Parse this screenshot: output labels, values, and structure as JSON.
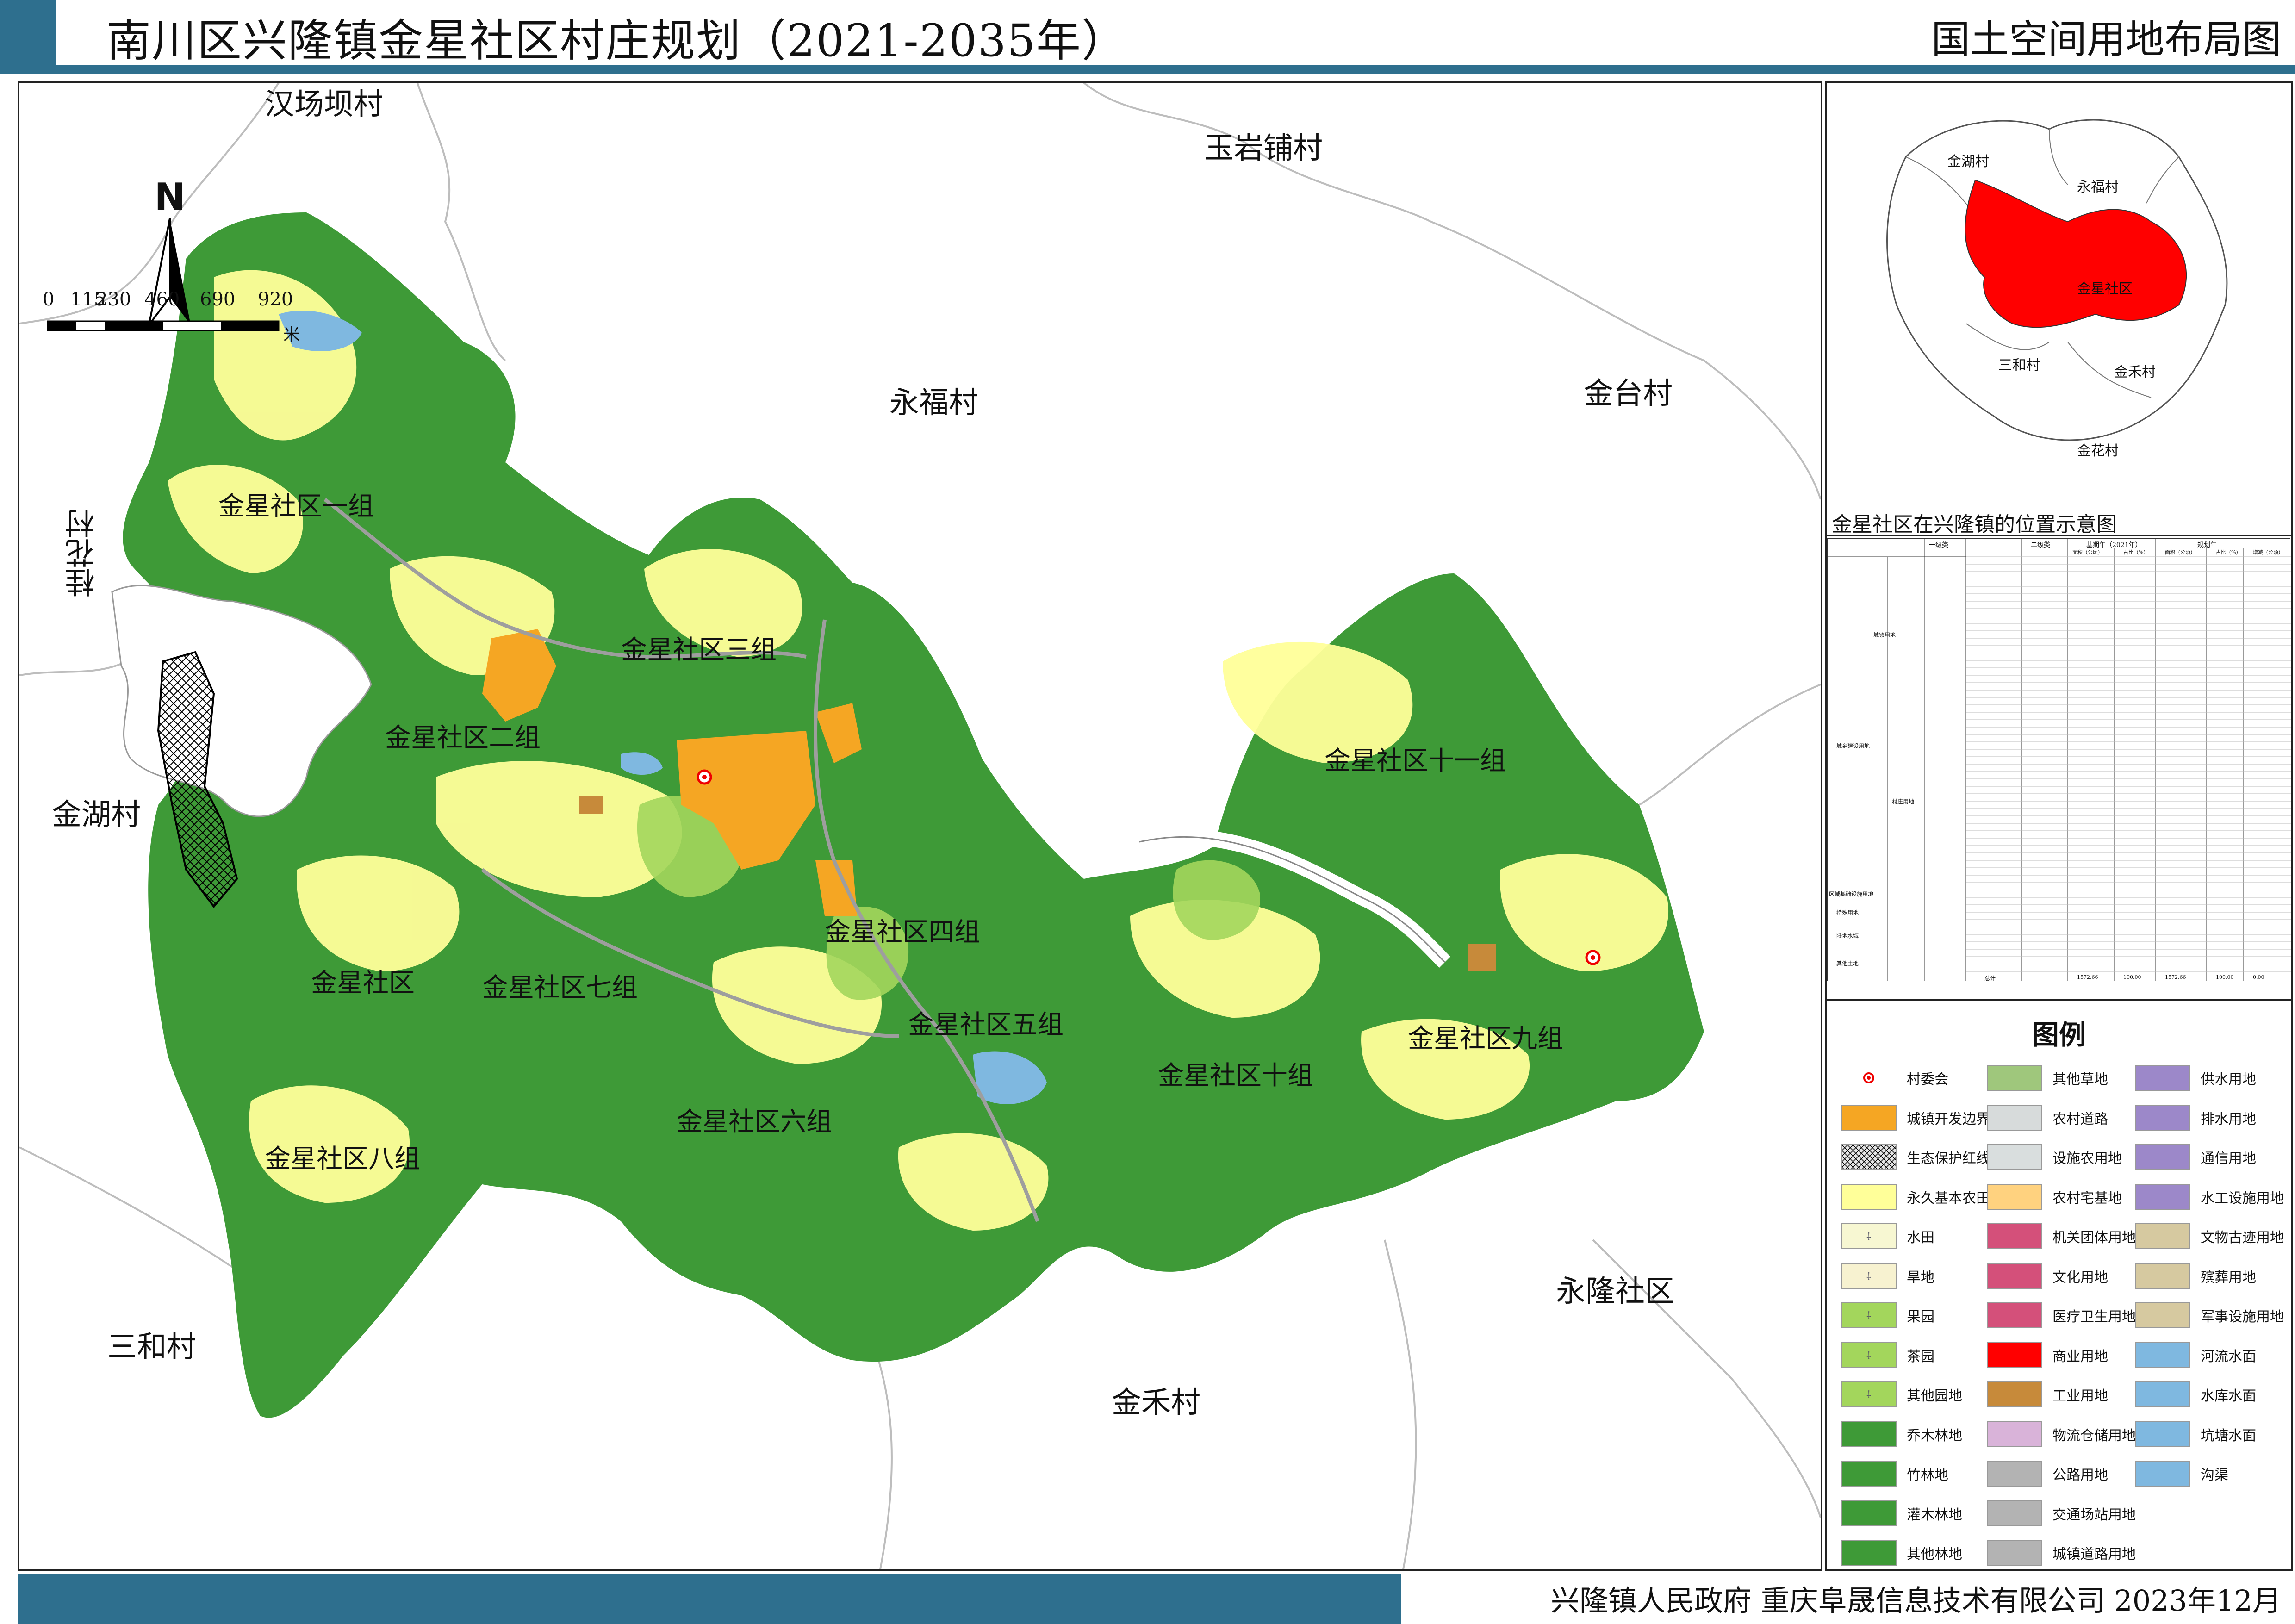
{
  "header": {
    "title": "南川区兴隆镇金星社区村庄规划（2021-2035年）",
    "subtitle": "国土空间用地布局图"
  },
  "map": {
    "north_label": "N",
    "scale": {
      "ticks": [
        "0",
        "115",
        "230",
        "460",
        "690",
        "920"
      ],
      "unit": "米"
    },
    "neighbors": [
      {
        "name": "汉场坝村"
      },
      {
        "name": "玉岩铺村"
      },
      {
        "name": "永福村"
      },
      {
        "name": "金台村"
      },
      {
        "name": "桂花村"
      },
      {
        "name": "金湖村"
      },
      {
        "name": "三和村"
      },
      {
        "name": "金禾村"
      },
      {
        "name": "永隆社区"
      }
    ],
    "groups": [
      {
        "name": "金星社区一组"
      },
      {
        "name": "金星社区二组"
      },
      {
        "name": "金星社区三组"
      },
      {
        "name": "金星社区四组"
      },
      {
        "name": "金星社区五组"
      },
      {
        "name": "金星社区六组"
      },
      {
        "name": "金星社区七组"
      },
      {
        "name": "金星社区八组"
      },
      {
        "name": "金星社区九组"
      },
      {
        "name": "金星社区十组"
      },
      {
        "name": "金星社区十一组"
      },
      {
        "name": "金星社区"
      }
    ]
  },
  "inset": {
    "caption": "金星社区在兴隆镇的位置示意图",
    "labels": [
      {
        "name": "金湖村"
      },
      {
        "name": "永福村"
      },
      {
        "name": "金星社区"
      },
      {
        "name": "三和村"
      },
      {
        "name": "金禾村"
      },
      {
        "name": "金花村"
      }
    ],
    "highlight_color": "#ff0000"
  },
  "table": {
    "headers": [
      "一级类",
      "二级类",
      "基期年（2021年）",
      "规划年"
    ],
    "sub_headers": [
      "面积（公顷）",
      "占比（%）",
      "面积（公顷）",
      "占比（%）",
      "增减（公顷）"
    ],
    "groups": [
      "城镇用地",
      "城乡建设用地",
      "村庄用地",
      "区域基础设施用地",
      "特殊用地",
      "陆地水域",
      "其他土地"
    ],
    "total_label": "总计",
    "total": [
      "1572.66",
      "100.00",
      "1572.66",
      "100.00",
      "0.00"
    ]
  },
  "legend": {
    "title": "图例",
    "items": [
      {
        "label": "村委会",
        "color": "#ffffff",
        "icon": "village-committee-icon"
      },
      {
        "label": "城镇开发边界",
        "color": "#f5a623"
      },
      {
        "label": "生态保护红线",
        "color": "#e6e6e6",
        "icon": "crosshatch"
      },
      {
        "label": "永久基本农田",
        "color": "#ffff99"
      },
      {
        "label": "水田",
        "color": "#f7f7d2",
        "icon": "paddy-symbol"
      },
      {
        "label": "旱地",
        "color": "#f7f2d0",
        "icon": "dryland-symbol"
      },
      {
        "label": "果园",
        "color": "#a3d65c",
        "icon": "orchard-symbol"
      },
      {
        "label": "茶园",
        "color": "#a3d65c",
        "icon": "tea-symbol"
      },
      {
        "label": "其他园地",
        "color": "#a3d65c",
        "icon": "garden-symbol"
      },
      {
        "label": "乔木林地",
        "color": "#3e9a37"
      },
      {
        "label": "竹林地",
        "color": "#3e9a37"
      },
      {
        "label": "灌木林地",
        "color": "#3e9a37"
      },
      {
        "label": "其他林地",
        "color": "#3e9a37"
      },
      {
        "label": "其他草地",
        "color": "#9fc77c"
      },
      {
        "label": "农村道路",
        "color": "#d7dbdb"
      },
      {
        "label": "设施农用地",
        "color": "#d9dede"
      },
      {
        "label": "农村宅基地",
        "color": "#ffd27f"
      },
      {
        "label": "机关团体用地",
        "color": "#d4507a"
      },
      {
        "label": "文化用地",
        "color": "#d4507a"
      },
      {
        "label": "医疗卫生用地",
        "color": "#d4507a"
      },
      {
        "label": "商业用地",
        "color": "#ff0000"
      },
      {
        "label": "工业用地",
        "color": "#c78a3a"
      },
      {
        "label": "物流仓储用地",
        "color": "#d9b3d9"
      },
      {
        "label": "公路用地",
        "color": "#b3b3b3"
      },
      {
        "label": "交通场站用地",
        "color": "#b3b3b3"
      },
      {
        "label": "城镇道路用地",
        "color": "#b3b3b3"
      },
      {
        "label": "供水用地",
        "color": "#9c88c9"
      },
      {
        "label": "排水用地",
        "color": "#9c88c9"
      },
      {
        "label": "通信用地",
        "color": "#9c88c9"
      },
      {
        "label": "水工设施用地",
        "color": "#9c88c9"
      },
      {
        "label": "文物古迹用地",
        "color": "#d6c9a0"
      },
      {
        "label": "殡葬用地",
        "color": "#d6c9a0"
      },
      {
        "label": "军事设施用地",
        "color": "#d6c9a0"
      },
      {
        "label": "河流水面",
        "color": "#7fb8e0"
      },
      {
        "label": "水库水面",
        "color": "#7fb8e0"
      },
      {
        "label": "坑塘水面",
        "color": "#7fb8e0"
      },
      {
        "label": "沟渠",
        "color": "#7fb8e0"
      }
    ]
  },
  "footer": {
    "text": "兴隆镇人民政府  重庆阜晟信息技术有限公司  2023年12月"
  }
}
